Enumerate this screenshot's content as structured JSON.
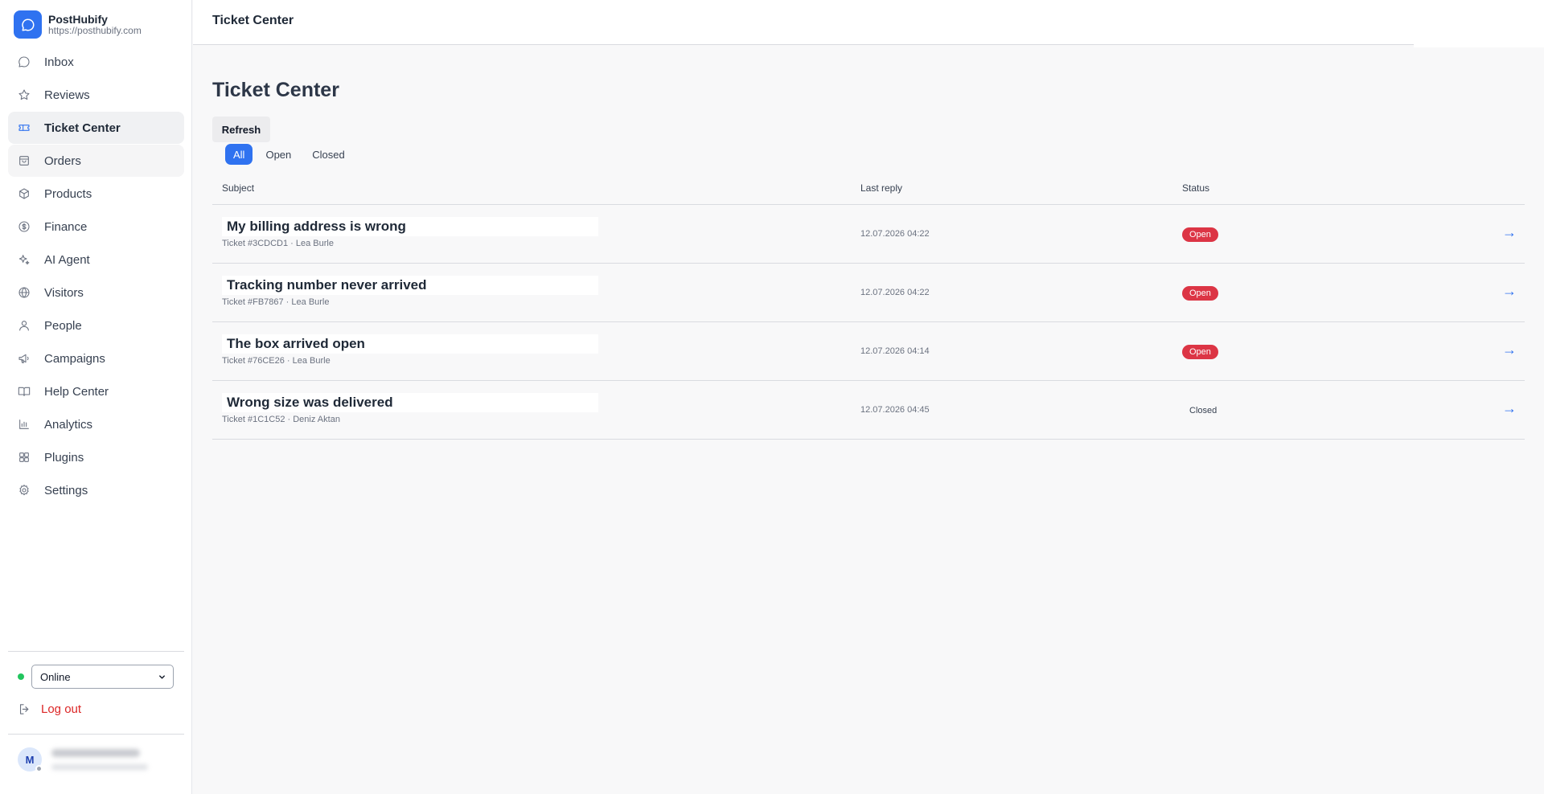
{
  "brand": {
    "name": "PostHubify",
    "url": "https://posthubify.com"
  },
  "sidebar": {
    "items": [
      {
        "label": "Inbox",
        "icon": "chat-bubble-icon"
      },
      {
        "label": "Reviews",
        "icon": "star-icon"
      },
      {
        "label": "Ticket Center",
        "icon": "ticket-icon"
      },
      {
        "label": "Orders",
        "icon": "shopping-bag-icon"
      },
      {
        "label": "Products",
        "icon": "box-icon"
      },
      {
        "label": "Finance",
        "icon": "dollar-circle-icon"
      },
      {
        "label": "AI Agent",
        "icon": "sparkles-icon"
      },
      {
        "label": "Visitors",
        "icon": "globe-icon"
      },
      {
        "label": "People",
        "icon": "user-icon"
      },
      {
        "label": "Campaigns",
        "icon": "megaphone-icon"
      },
      {
        "label": "Help Center",
        "icon": "book-open-icon"
      },
      {
        "label": "Analytics",
        "icon": "bar-chart-icon"
      },
      {
        "label": "Plugins",
        "icon": "grid-icon"
      },
      {
        "label": "Settings",
        "icon": "gear-icon"
      }
    ],
    "status_select": "Online",
    "logout_label": "Log out",
    "avatar_initial": "M"
  },
  "header": {
    "title": "Ticket Center"
  },
  "main": {
    "title": "Ticket Center",
    "refresh_label": "Refresh",
    "filters": [
      "All",
      "Open",
      "Closed"
    ],
    "columns": {
      "subject": "Subject",
      "last_reply": "Last reply",
      "status": "Status"
    },
    "tickets": [
      {
        "subject": "My billing address is wrong",
        "meta": "Ticket #3CDCD1 · Lea Burle",
        "last_reply": "12.07.2026 04:22",
        "status": "Open"
      },
      {
        "subject": "Tracking number never arrived",
        "meta": "Ticket #FB7867 · Lea Burle",
        "last_reply": "12.07.2026 04:22",
        "status": "Open"
      },
      {
        "subject": "The box arrived open",
        "meta": "Ticket #76CE26 · Lea Burle",
        "last_reply": "12.07.2026 04:14",
        "status": "Open"
      },
      {
        "subject": "Wrong size was delivered",
        "meta": "Ticket #1C1C52 · Deniz Aktan",
        "last_reply": "12.07.2026 04:45",
        "status": "Closed"
      }
    ],
    "row_action_icon": "→"
  },
  "colors": {
    "accent": "#2f72f0",
    "danger": "#dc3545",
    "online": "#22c55e",
    "logout": "#dc2626"
  }
}
